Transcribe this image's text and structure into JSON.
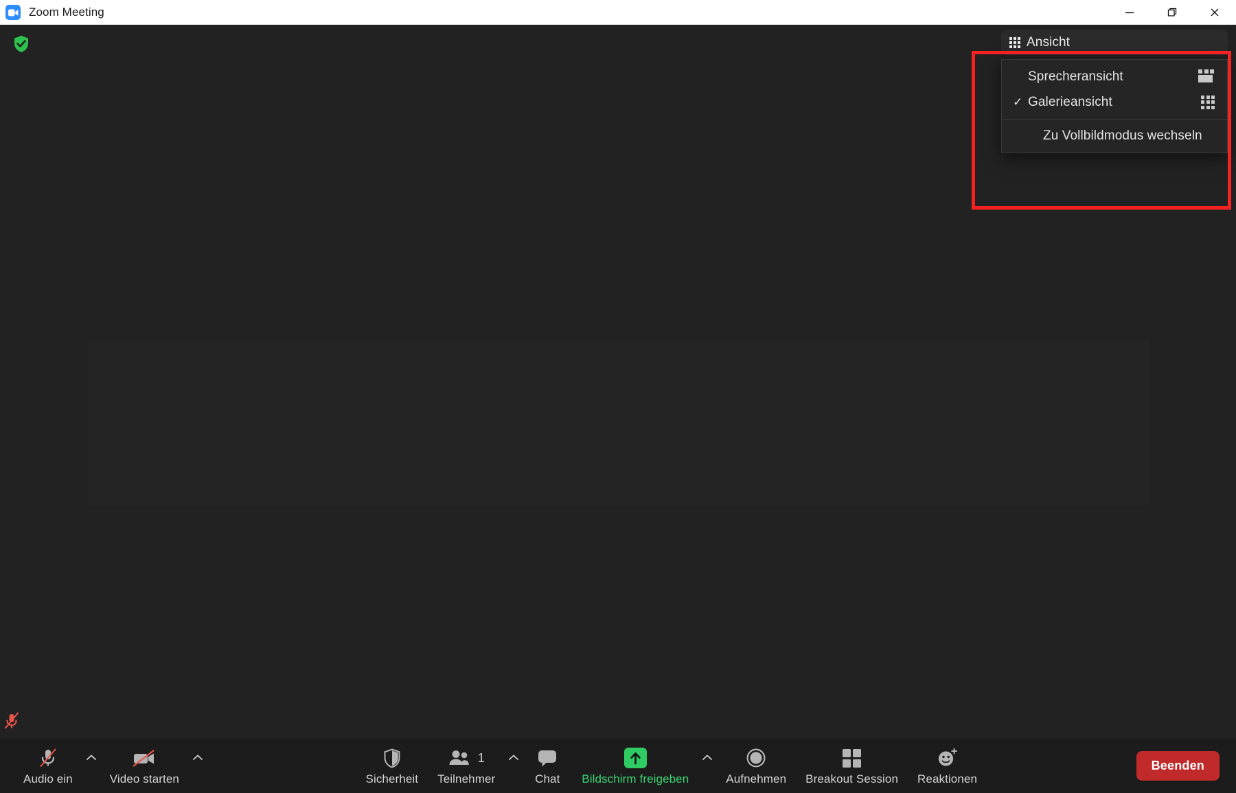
{
  "window": {
    "title": "Zoom Meeting",
    "logo_icon": "zoom-camera-icon",
    "controls": {
      "minimize": "minimize-icon",
      "restore": "restore-icon",
      "close": "close-icon"
    }
  },
  "stage": {
    "encryption_icon": "green-shield-check-icon",
    "mic_status_icon": "muted-microphone-icon"
  },
  "view_control": {
    "button_label": "Ansicht",
    "button_icon": "grid-view-icon",
    "menu": {
      "items": [
        {
          "label": "Sprecheransicht",
          "checked": "",
          "icon": "speaker-view-icon"
        },
        {
          "label": "Galerieansicht",
          "checked": "✓",
          "icon": "gallery-view-icon"
        }
      ],
      "fullscreen": {
        "label": "Zu Vollbildmodus wechseln",
        "checked": "",
        "icon": ""
      }
    }
  },
  "toolbar": {
    "audio": {
      "label": "Audio ein",
      "icon": "microphone-muted-icon"
    },
    "video": {
      "label": "Video starten",
      "icon": "camera-muted-icon"
    },
    "security": {
      "label": "Sicherheit",
      "icon": "shield-icon"
    },
    "participants": {
      "label": "Teilnehmer",
      "icon": "people-icon",
      "count": "1"
    },
    "chat": {
      "label": "Chat",
      "icon": "speech-bubble-icon"
    },
    "share": {
      "label": "Bildschirm freigeben",
      "icon": "share-screen-up-arrow-icon"
    },
    "record": {
      "label": "Aufnehmen",
      "icon": "record-circle-icon"
    },
    "breakout": {
      "label": "Breakout Session",
      "icon": "four-squares-icon"
    },
    "reactions": {
      "label": "Reaktionen",
      "icon": "smiley-plus-icon"
    },
    "leave": {
      "label": "Beenden"
    }
  },
  "colors": {
    "accent_green": "#2ecc63",
    "leave_red": "#c02a2a",
    "highlight_red": "#f52222",
    "zoom_blue": "#2D8CFF",
    "shield_green": "#2fc14f"
  }
}
